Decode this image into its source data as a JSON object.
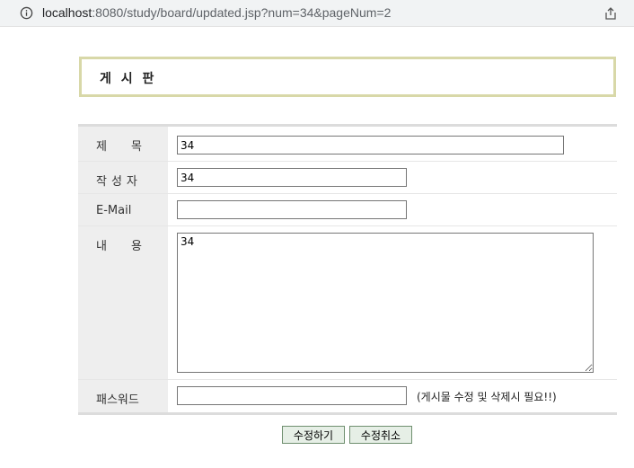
{
  "browser": {
    "url_host": "localhost",
    "url_rest": ":8080/study/board/updated.jsp?num=34&pageNum=2"
  },
  "board": {
    "title": "게 시 판"
  },
  "form": {
    "subject_label": "제목",
    "subject_value": "34",
    "writer_label": "작성자",
    "writer_value": "34",
    "email_label": "E-Mail",
    "email_value": "",
    "content_label": "내용",
    "content_value": "34",
    "password_label": "패스워드",
    "password_value": "",
    "password_note": "(게시물 수정 및 삭제시 필요!!)"
  },
  "buttons": {
    "update_label": "수정하기",
    "cancel_label": "수정취소"
  },
  "icons": {
    "site_info": "info-icon",
    "share": "share-icon"
  }
}
